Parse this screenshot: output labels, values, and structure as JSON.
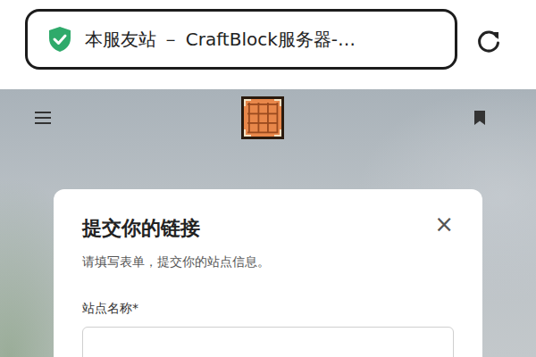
{
  "browser": {
    "title": "本服友站 － CraftBlock服务器-…",
    "secure": true
  },
  "modal": {
    "title": "提交你的链接",
    "close": "×",
    "subtitle": "请填写表单，提交你的站点信息。",
    "fields": [
      {
        "label": "站点名称*"
      }
    ]
  }
}
